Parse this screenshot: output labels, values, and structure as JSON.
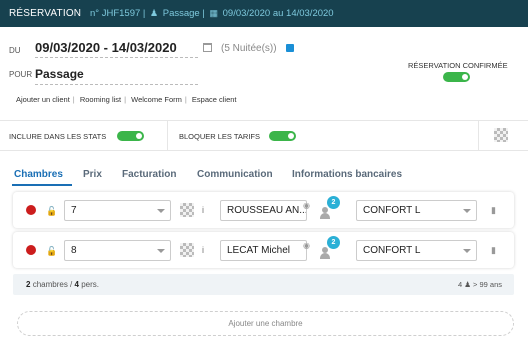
{
  "titlebar": {
    "title": "RÉSERVATION",
    "ref": "n° JHF1597",
    "guest": "Passage",
    "dates": "09/03/2020 au 14/03/2020"
  },
  "du": {
    "label": "DU",
    "value": "09/03/2020 - 14/03/2020",
    "nights": "(5 Nuitée(s))"
  },
  "pour": {
    "label": "POUR",
    "value": "Passage"
  },
  "links": [
    "Ajouter un client",
    "Rooming list",
    "Welcome Form",
    "Espace client"
  ],
  "confirmed": {
    "label": "RÉSERVATION CONFIRMÉE",
    "on": true
  },
  "stats": {
    "include_label": "INCLURE DANS LES STATS",
    "include_on": true,
    "block_label": "BLOQUER LES TARIFS",
    "block_on": true
  },
  "tabs": [
    "Chambres",
    "Prix",
    "Facturation",
    "Communication",
    "Informations bancaires"
  ],
  "active_tab": "Chambres",
  "rooms": [
    {
      "number": "7",
      "client": "ROUSSEAU AN...",
      "persons": "2",
      "type": "CONFORT L"
    },
    {
      "number": "8",
      "client": "LECAT Michel",
      "persons": "2",
      "type": "CONFORT L"
    }
  ],
  "summary": {
    "rooms_count": "2",
    "rooms_text": "chambres /",
    "persons_count": "4",
    "persons_text": "pers.",
    "right": "4 ♟ > 99 ans"
  },
  "add_room": "Ajouter une chambre",
  "colors": {
    "header": "#17414f",
    "accent": "#1a6fb5",
    "toggle": "#3bb54a",
    "badge": "#2bb0d6",
    "status_dot": "#cc1d1d"
  }
}
